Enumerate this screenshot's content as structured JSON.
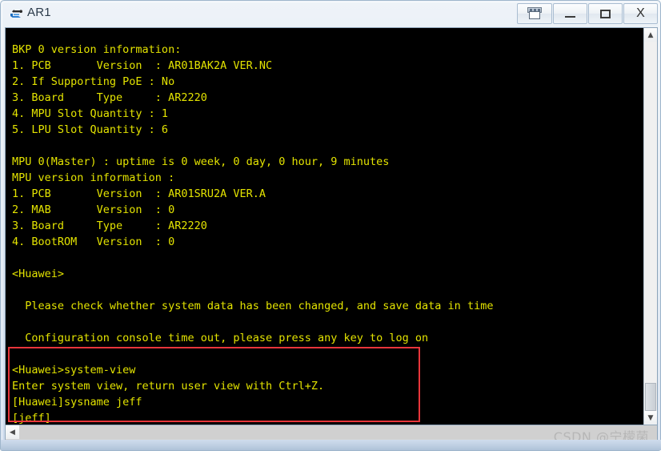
{
  "window": {
    "title": "AR1",
    "icon": "router-icon",
    "buttons": [
      {
        "name": "restore-all",
        "label": "",
        "icon": "window-restore-icon"
      },
      {
        "name": "minimize",
        "label": "—",
        "icon": "minimize-icon"
      },
      {
        "name": "maximize",
        "label": "",
        "icon": "maximize-icon"
      },
      {
        "name": "close",
        "label": "X",
        "icon": "close-icon"
      }
    ]
  },
  "terminal": {
    "foreground": "#e3e300",
    "background": "#000000",
    "lines": [
      "BKP 0 version information:",
      "1. PCB       Version  : AR01BAK2A VER.NC",
      "2. If Supporting PoE : No",
      "3. Board     Type     : AR2220",
      "4. MPU Slot Quantity : 1",
      "5. LPU Slot Quantity : 6",
      "",
      "MPU 0(Master) : uptime is 0 week, 0 day, 0 hour, 9 minutes",
      "MPU version information :",
      "1. PCB       Version  : AR01SRU2A VER.A",
      "2. MAB       Version  : 0",
      "3. Board     Type     : AR2220",
      "4. BootROM   Version  : 0",
      "",
      "<Huawei>",
      "",
      "  Please check whether system data has been changed, and save data in time",
      "",
      "  Configuration console time out, please press any key to log on",
      "",
      "<Huawei>system-view",
      "Enter system view, return user view with Ctrl+Z.",
      "[Huawei]sysname jeff",
      "[jeff]"
    ]
  },
  "annotation": {
    "name": "red-highlight-box",
    "color": "#e8353a",
    "covers": [
      "<Huawei>system-view",
      "Enter system view, return user view with Ctrl+Z.",
      "[Huawei]sysname jeff",
      "[jeff]"
    ]
  },
  "scrollbars": {
    "vertical": {
      "up_arrow": "▲",
      "down_arrow": "▼"
    },
    "horizontal": {
      "left_arrow": "◀"
    }
  },
  "watermark": {
    "text": "CSDN @宁檬菌"
  }
}
